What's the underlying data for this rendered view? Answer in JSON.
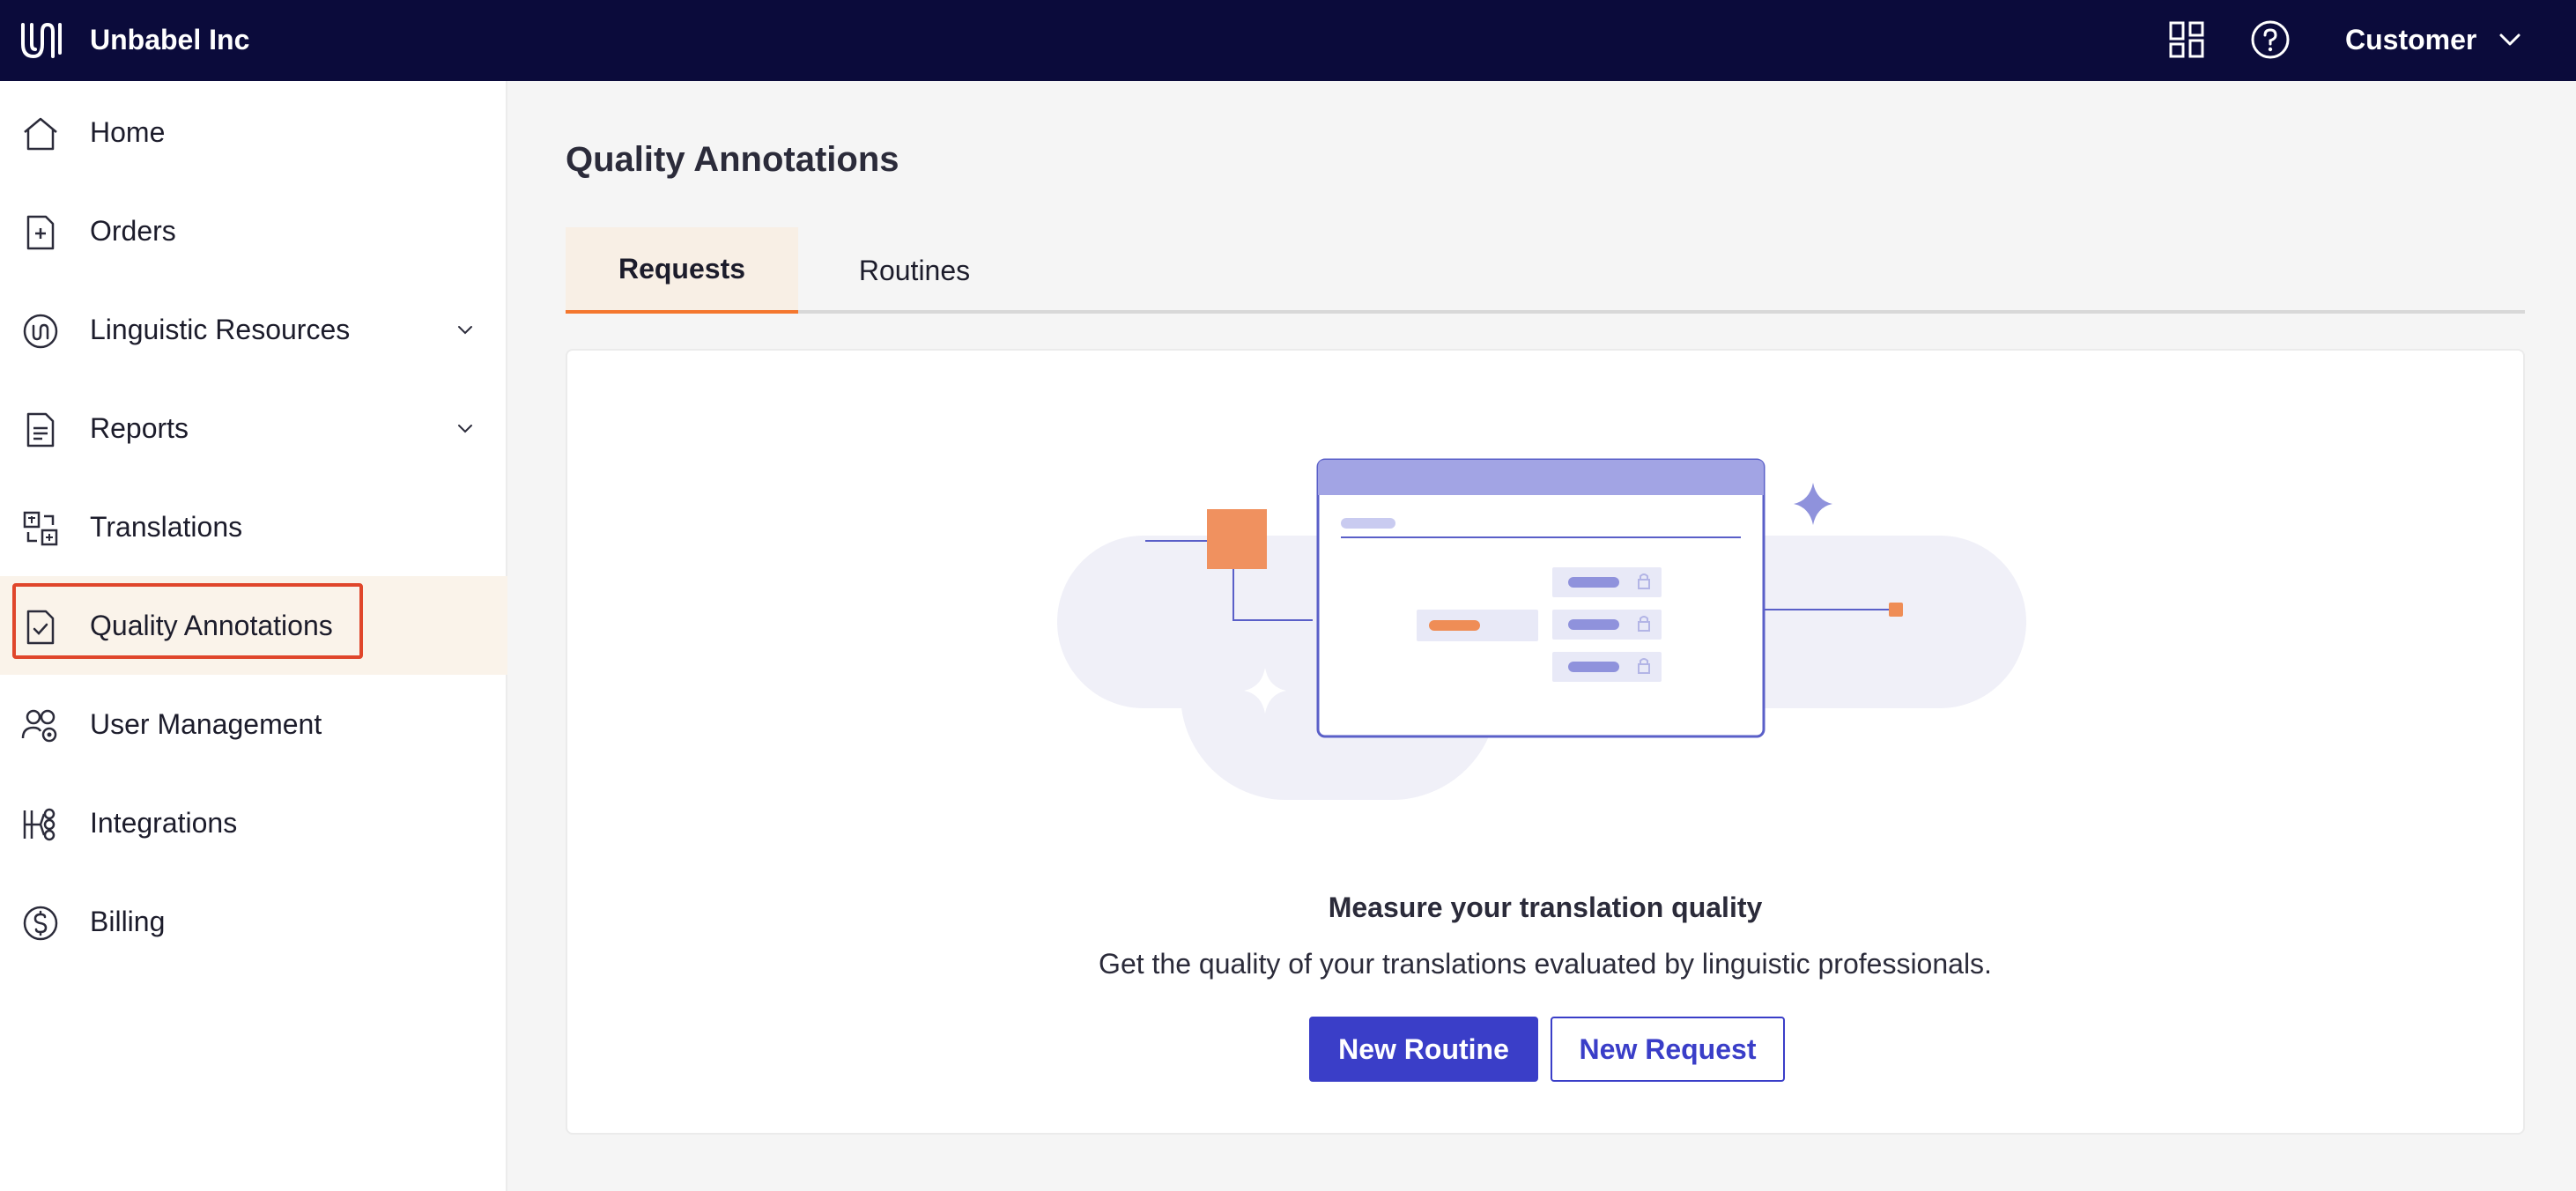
{
  "topbar": {
    "brand_name": "Unbabel Inc",
    "user_label": "Customer",
    "icons": [
      "unbabel-logo-icon",
      "apps-grid-icon",
      "help-icon",
      "chevron-down-icon"
    ]
  },
  "sidebar": {
    "items": [
      {
        "label": "Home",
        "icon": "home-icon"
      },
      {
        "label": "Orders",
        "icon": "orders-icon"
      },
      {
        "label": "Linguistic Resources",
        "icon": "linguistic-resources-icon",
        "expandable": true
      },
      {
        "label": "Reports",
        "icon": "reports-icon",
        "expandable": true
      },
      {
        "label": "Translations",
        "icon": "translations-icon"
      },
      {
        "label": "Quality Annotations",
        "icon": "quality-annotations-icon",
        "active": true
      },
      {
        "label": "User Management",
        "icon": "user-management-icon"
      },
      {
        "label": "Integrations",
        "icon": "integrations-icon"
      },
      {
        "label": "Billing",
        "icon": "billing-icon"
      }
    ]
  },
  "main": {
    "title": "Quality Annotations",
    "tabs": [
      {
        "label": "Requests",
        "active": true
      },
      {
        "label": "Routines",
        "active": false
      }
    ],
    "empty_state": {
      "title": "Measure your translation quality",
      "description": "Get the quality of your translations evaluated by linguistic professionals.",
      "primary_button": "New Routine",
      "secondary_button": "New Request"
    }
  },
  "colors": {
    "topbar_bg": "#0b0b3b",
    "accent_orange": "#f4772e",
    "primary_blue": "#3a3ec8",
    "highlight_red": "#e0462b",
    "active_nav_bg": "#faf3ea"
  }
}
